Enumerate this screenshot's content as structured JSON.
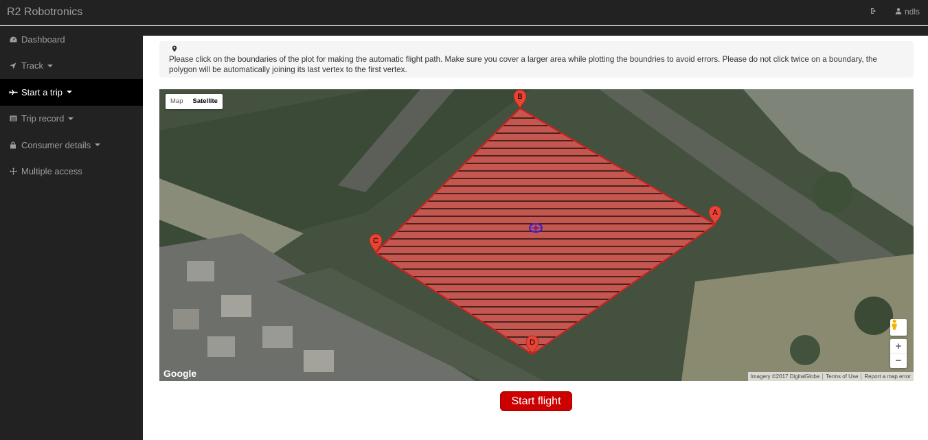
{
  "app": {
    "brand": "R2 Robotronics"
  },
  "header": {
    "user_name": "ndls",
    "logout_icon": "sign-out-icon",
    "user_icon": "user-icon"
  },
  "sidebar": {
    "items": [
      {
        "label": "Dashboard",
        "icon": "dashboard-icon",
        "has_caret": false,
        "active": false
      },
      {
        "label": "Track",
        "icon": "location-arrow-icon",
        "has_caret": true,
        "active": false
      },
      {
        "label": "Start a trip",
        "icon": "plane-icon",
        "has_caret": true,
        "active": true
      },
      {
        "label": "Trip record",
        "icon": "list-icon",
        "has_caret": true,
        "active": false
      },
      {
        "label": "Consumer details",
        "icon": "lock-icon",
        "has_caret": true,
        "active": false
      },
      {
        "label": "Multiple access",
        "icon": "arrows-icon",
        "has_caret": false,
        "active": false
      }
    ]
  },
  "instruction": {
    "icon": "map-marker-icon",
    "text": "Please click on the boundaries of the plot for making the automatic flight path. Make sure you cover a larger area while plotting the boundries to avoid errors. Please do not click twice on a boundary, the polygon will be automatically joining its last vertex to the first vertex."
  },
  "map": {
    "type_controls": {
      "map_label": "Map",
      "satellite_label": "Satellite",
      "selected": "Satellite"
    },
    "markers": [
      {
        "label": "A"
      },
      {
        "label": "B"
      },
      {
        "label": "C"
      },
      {
        "label": "D"
      }
    ],
    "polygon_colors": {
      "fill": "#e05a55",
      "stroke": "#d81e1e",
      "hatch": "#000000"
    },
    "logo": "Google",
    "attribution": [
      "Imagery ©2017 DigitalGlobe",
      "Terms of Use",
      "Report a map error"
    ],
    "zoom_in": "+",
    "zoom_out": "−"
  },
  "actions": {
    "start_flight": "Start flight"
  },
  "colors": {
    "navbar": "#222222",
    "active_nav": "#000000",
    "accent": "#cc0000"
  }
}
